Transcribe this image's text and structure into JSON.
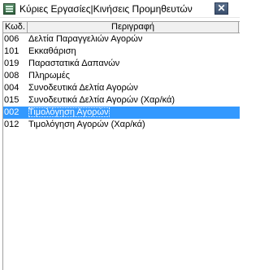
{
  "window": {
    "title": "Κύριες Εργασίες|Κινήσεις Προμηθευτών",
    "close_label": "✕",
    "icon": "app-icon"
  },
  "columns": {
    "code": "Κωδ.",
    "description": "Περιγραφή"
  },
  "rows": [
    {
      "code": "006",
      "description": "Δελτία Παραγγελιών Αγορών"
    },
    {
      "code": "101",
      "description": "Εκκαθάριση"
    },
    {
      "code": "019",
      "description": "Παραστατικά Δαπανών"
    },
    {
      "code": "008",
      "description": "Πληρωμές"
    },
    {
      "code": "004",
      "description": "Συνοδευτικά Δελτία Αγορών"
    },
    {
      "code": "015",
      "description": "Συνοδευτικά Δελτία Αγορών (Χαρ/κά)"
    },
    {
      "code": "002",
      "description": "Τιμολόγηση Αγορών"
    },
    {
      "code": "012",
      "description": "Τιμολόγηση Αγορών (Χαρ/κά)"
    }
  ],
  "selected_row": 6,
  "colors": {
    "selection": "#3399ff",
    "close_button": "#4a5f7e"
  }
}
